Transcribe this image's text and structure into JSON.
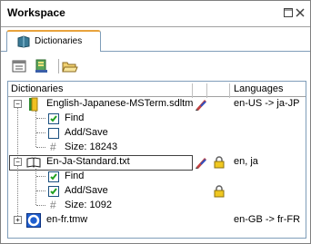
{
  "window": {
    "title": "Workspace"
  },
  "tabs": [
    {
      "label": "Dictionaries"
    }
  ],
  "toolbar": {
    "buttons": [
      "properties-icon",
      "new-dictionary-icon",
      "open-folder-icon"
    ]
  },
  "grid": {
    "columns": [
      "Dictionaries",
      "Languages"
    ],
    "rows": [
      {
        "type": "dictionary",
        "name": "English-Japanese-MSTerm.sdltm",
        "languages": "en-US -> ja-JP",
        "expanded": true,
        "locked": false
      },
      {
        "type": "option",
        "label": "Find",
        "checked": true
      },
      {
        "type": "option",
        "label": "Add/Save",
        "checked": false
      },
      {
        "type": "size",
        "label": "Size: 18243"
      },
      {
        "type": "dictionary",
        "name": "En-Ja-Standard.txt",
        "languages": "en, ja",
        "expanded": true,
        "locked": true
      },
      {
        "type": "option",
        "label": "Find",
        "checked": true
      },
      {
        "type": "option",
        "label": "Add/Save",
        "checked": true,
        "locked": true
      },
      {
        "type": "size",
        "label": "Size: 1092"
      },
      {
        "type": "dictionary",
        "name": "en-fr.tmw",
        "languages": "en-GB -> fr-FR",
        "expanded": false,
        "locked": false
      }
    ]
  },
  "colors": {
    "tab_accent": "#e8a33d",
    "border": "#7f9db9"
  }
}
